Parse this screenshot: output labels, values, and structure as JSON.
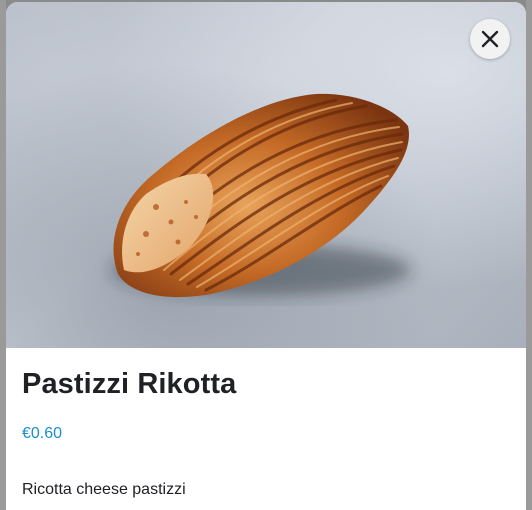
{
  "product": {
    "name": "Pastizzi Rikotta",
    "price": "€0.60",
    "description": "Ricotta cheese pastizzi",
    "image_icon": "pastry-photo"
  },
  "close": {
    "icon": "close-icon"
  },
  "colors": {
    "price": "#1a8ed1",
    "title": "#202125",
    "close_bg": "#f2f2f2"
  }
}
